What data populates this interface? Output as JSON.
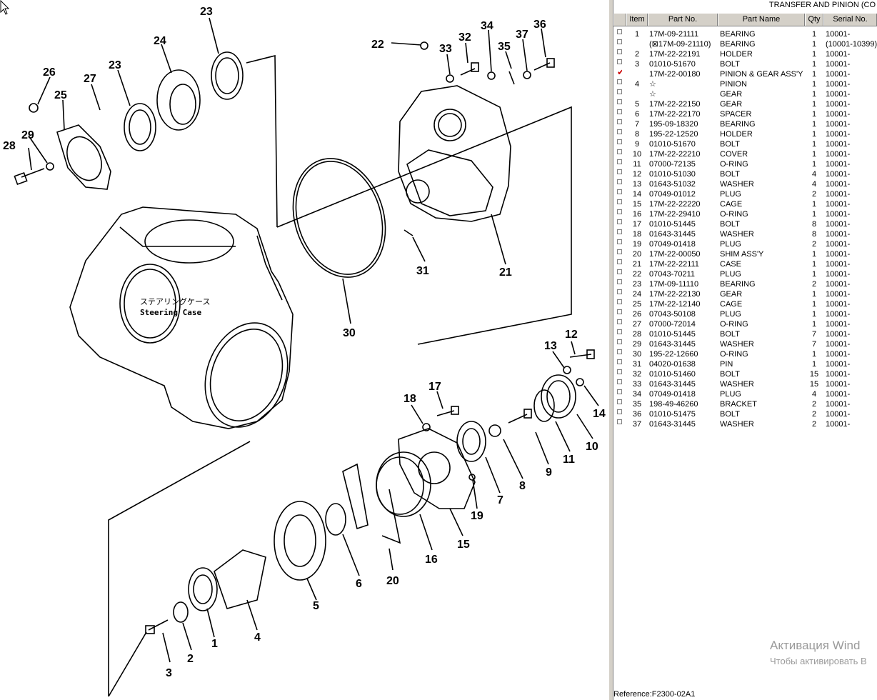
{
  "panel": {
    "title": "TRANSFER AND PINION (CO",
    "columns": [
      "Item",
      "Part No.",
      "Part Name",
      "Qty",
      "Serial No."
    ],
    "rows": [
      {
        "item": "1",
        "part_no": "17M-09-21111",
        "name": "BEARING",
        "qty": "1",
        "serial": "10001-",
        "checked": false
      },
      {
        "item": "",
        "part_no": "(⊠17M-09-21110)",
        "name": "BEARING",
        "qty": "1",
        "serial": "(10001-10399)",
        "checked": false
      },
      {
        "item": "2",
        "part_no": "17M-22-22191",
        "name": "HOLDER",
        "qty": "1",
        "serial": "10001-",
        "checked": false
      },
      {
        "item": "3",
        "part_no": "01010-51670",
        "name": "BOLT",
        "qty": "1",
        "serial": "10001-",
        "checked": false
      },
      {
        "item": "",
        "part_no": "17M-22-00180",
        "name": "PINION & GEAR ASS'Y",
        "qty": "1",
        "serial": "10001-",
        "checked": true
      },
      {
        "item": "4",
        "part_no": "☆",
        "name": "PINION",
        "qty": "1",
        "serial": "10001-",
        "checked": false
      },
      {
        "item": "",
        "part_no": "☆",
        "name": "GEAR",
        "qty": "1",
        "serial": "10001-",
        "checked": false
      },
      {
        "item": "5",
        "part_no": "17M-22-22150",
        "name": "GEAR",
        "qty": "1",
        "serial": "10001-",
        "checked": false
      },
      {
        "item": "6",
        "part_no": "17M-22-22170",
        "name": "SPACER",
        "qty": "1",
        "serial": "10001-",
        "checked": false
      },
      {
        "item": "7",
        "part_no": "195-09-18320",
        "name": "BEARING",
        "qty": "1",
        "serial": "10001-",
        "checked": false
      },
      {
        "item": "8",
        "part_no": "195-22-12520",
        "name": "HOLDER",
        "qty": "1",
        "serial": "10001-",
        "checked": false
      },
      {
        "item": "9",
        "part_no": "01010-51670",
        "name": "BOLT",
        "qty": "1",
        "serial": "10001-",
        "checked": false
      },
      {
        "item": "10",
        "part_no": "17M-22-22210",
        "name": "COVER",
        "qty": "1",
        "serial": "10001-",
        "checked": false
      },
      {
        "item": "11",
        "part_no": "07000-72135",
        "name": "O-RING",
        "qty": "1",
        "serial": "10001-",
        "checked": false
      },
      {
        "item": "12",
        "part_no": "01010-51030",
        "name": "BOLT",
        "qty": "4",
        "serial": "10001-",
        "checked": false
      },
      {
        "item": "13",
        "part_no": "01643-51032",
        "name": "WASHER",
        "qty": "4",
        "serial": "10001-",
        "checked": false
      },
      {
        "item": "14",
        "part_no": "07049-01012",
        "name": "PLUG",
        "qty": "2",
        "serial": "10001-",
        "checked": false
      },
      {
        "item": "15",
        "part_no": "17M-22-22220",
        "name": "CAGE",
        "qty": "1",
        "serial": "10001-",
        "checked": false
      },
      {
        "item": "16",
        "part_no": "17M-22-29410",
        "name": "O-RING",
        "qty": "1",
        "serial": "10001-",
        "checked": false
      },
      {
        "item": "17",
        "part_no": "01010-51445",
        "name": "BOLT",
        "qty": "8",
        "serial": "10001-",
        "checked": false
      },
      {
        "item": "18",
        "part_no": "01643-31445",
        "name": "WASHER",
        "qty": "8",
        "serial": "10001-",
        "checked": false
      },
      {
        "item": "19",
        "part_no": "07049-01418",
        "name": "PLUG",
        "qty": "2",
        "serial": "10001-",
        "checked": false
      },
      {
        "item": "20",
        "part_no": "17M-22-00050",
        "name": "SHIM ASS'Y",
        "qty": "1",
        "serial": "10001-",
        "checked": false
      },
      {
        "item": "21",
        "part_no": "17M-22-22111",
        "name": "CASE",
        "qty": "1",
        "serial": "10001-",
        "checked": false
      },
      {
        "item": "22",
        "part_no": "07043-70211",
        "name": "PLUG",
        "qty": "1",
        "serial": "10001-",
        "checked": false
      },
      {
        "item": "23",
        "part_no": "17M-09-11110",
        "name": "BEARING",
        "qty": "2",
        "serial": "10001-",
        "checked": false
      },
      {
        "item": "24",
        "part_no": "17M-22-22130",
        "name": "GEAR",
        "qty": "1",
        "serial": "10001-",
        "checked": false
      },
      {
        "item": "25",
        "part_no": "17M-22-12140",
        "name": "CAGE",
        "qty": "1",
        "serial": "10001-",
        "checked": false
      },
      {
        "item": "26",
        "part_no": "07043-50108",
        "name": "PLUG",
        "qty": "1",
        "serial": "10001-",
        "checked": false
      },
      {
        "item": "27",
        "part_no": "07000-72014",
        "name": "O-RING",
        "qty": "1",
        "serial": "10001-",
        "checked": false
      },
      {
        "item": "28",
        "part_no": "01010-51445",
        "name": "BOLT",
        "qty": "7",
        "serial": "10001-",
        "checked": false
      },
      {
        "item": "29",
        "part_no": "01643-31445",
        "name": "WASHER",
        "qty": "7",
        "serial": "10001-",
        "checked": false
      },
      {
        "item": "30",
        "part_no": "195-22-12660",
        "name": "O-RING",
        "qty": "1",
        "serial": "10001-",
        "checked": false
      },
      {
        "item": "31",
        "part_no": "04020-01638",
        "name": "PIN",
        "qty": "1",
        "serial": "10001-",
        "checked": false
      },
      {
        "item": "32",
        "part_no": "01010-51460",
        "name": "BOLT",
        "qty": "15",
        "serial": "10001-",
        "checked": false
      },
      {
        "item": "33",
        "part_no": "01643-31445",
        "name": "WASHER",
        "qty": "15",
        "serial": "10001-",
        "checked": false
      },
      {
        "item": "34",
        "part_no": "07049-01418",
        "name": "PLUG",
        "qty": "4",
        "serial": "10001-",
        "checked": false
      },
      {
        "item": "35",
        "part_no": "198-49-46260",
        "name": "BRACKET",
        "qty": "2",
        "serial": "10001-",
        "checked": false
      },
      {
        "item": "36",
        "part_no": "01010-51475",
        "name": "BOLT",
        "qty": "2",
        "serial": "10001-",
        "checked": false
      },
      {
        "item": "37",
        "part_no": "01643-31445",
        "name": "WASHER",
        "qty": "2",
        "serial": "10001-",
        "checked": false
      }
    ],
    "reference": "Reference:F2300-02A1"
  },
  "diagram": {
    "case_label_jp": "ステアリングケース",
    "case_label_en": "Steering  Case",
    "callouts": [
      "1",
      "2",
      "3",
      "4",
      "5",
      "6",
      "7",
      "8",
      "9",
      "10",
      "11",
      "12",
      "13",
      "14",
      "15",
      "16",
      "17",
      "18",
      "19",
      "20",
      "21",
      "22",
      "23",
      "24",
      "25",
      "26",
      "27",
      "28",
      "29",
      "30",
      "31",
      "32",
      "33",
      "34",
      "35",
      "36",
      "37",
      "23"
    ]
  },
  "watermark": {
    "line1": "Активация Wind",
    "line2": "Чтобы активировать В"
  },
  "colors": {
    "check": "#cc0000",
    "chrome": "#d4d0c8"
  }
}
